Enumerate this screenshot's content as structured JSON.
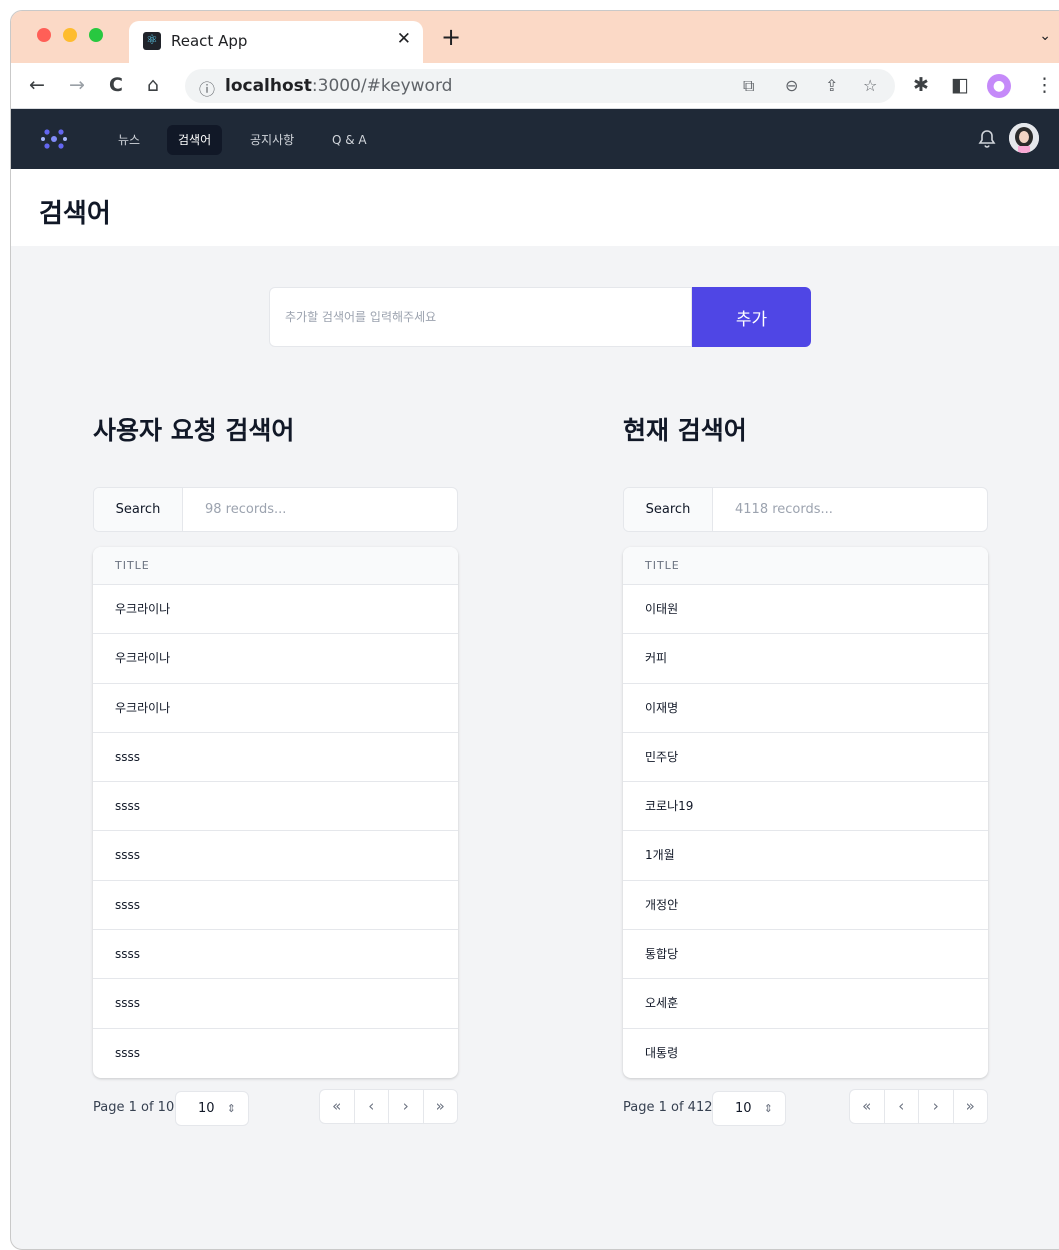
{
  "browser": {
    "tab_title": "React App",
    "tab_close": "✕",
    "new_tab": "+",
    "tab_search": "⌄",
    "url_host": "localhost",
    "url_rest": ":3000/#keyword",
    "info_icon": "ⓘ",
    "back": "←",
    "forward": "→",
    "reload": "C",
    "home": "⌂",
    "translate": "⧉",
    "zoom": "⊖",
    "share": "⇪",
    "star": "☆",
    "extensions": "✱",
    "sidepanel": "◧",
    "profile": "●",
    "menu": "⋮"
  },
  "nav": {
    "items": [
      "뉴스",
      "검색어",
      "공지사항",
      "Q & A"
    ],
    "active": "검색어"
  },
  "page": {
    "title": "검색어"
  },
  "add_form": {
    "placeholder": "추가할 검색어를 입력해주세요",
    "button": "추가"
  },
  "user_requests": {
    "title": "사용자 요청 검색어",
    "search_label": "Search",
    "search_placeholder": "98 records...",
    "column": "TITLE",
    "rows": [
      "우크라이나",
      "우크라이나",
      "우크라이나",
      "ssss",
      "ssss",
      "ssss",
      "ssss",
      "ssss",
      "ssss",
      "ssss"
    ],
    "page_info": "Page 1 of 10",
    "page_size": "10"
  },
  "current": {
    "title": "현재 검색어",
    "search_label": "Search",
    "search_placeholder": "4118 records...",
    "column": "TITLE",
    "rows": [
      "이태원",
      "커피",
      "이재명",
      "민주당",
      "코로나19",
      "1개월",
      "개정안",
      "통합당",
      "오세훈",
      "대통령"
    ],
    "page_info": "Page 1 of 412",
    "page_size": "10"
  },
  "pager_buttons": {
    "first": "«",
    "prev": "‹",
    "next": "›",
    "last": "»",
    "caret": "⇕"
  },
  "colors": {
    "accent": "#4f46e5",
    "navbar": "#1f2937",
    "tabstrip": "#fbd9c6"
  }
}
